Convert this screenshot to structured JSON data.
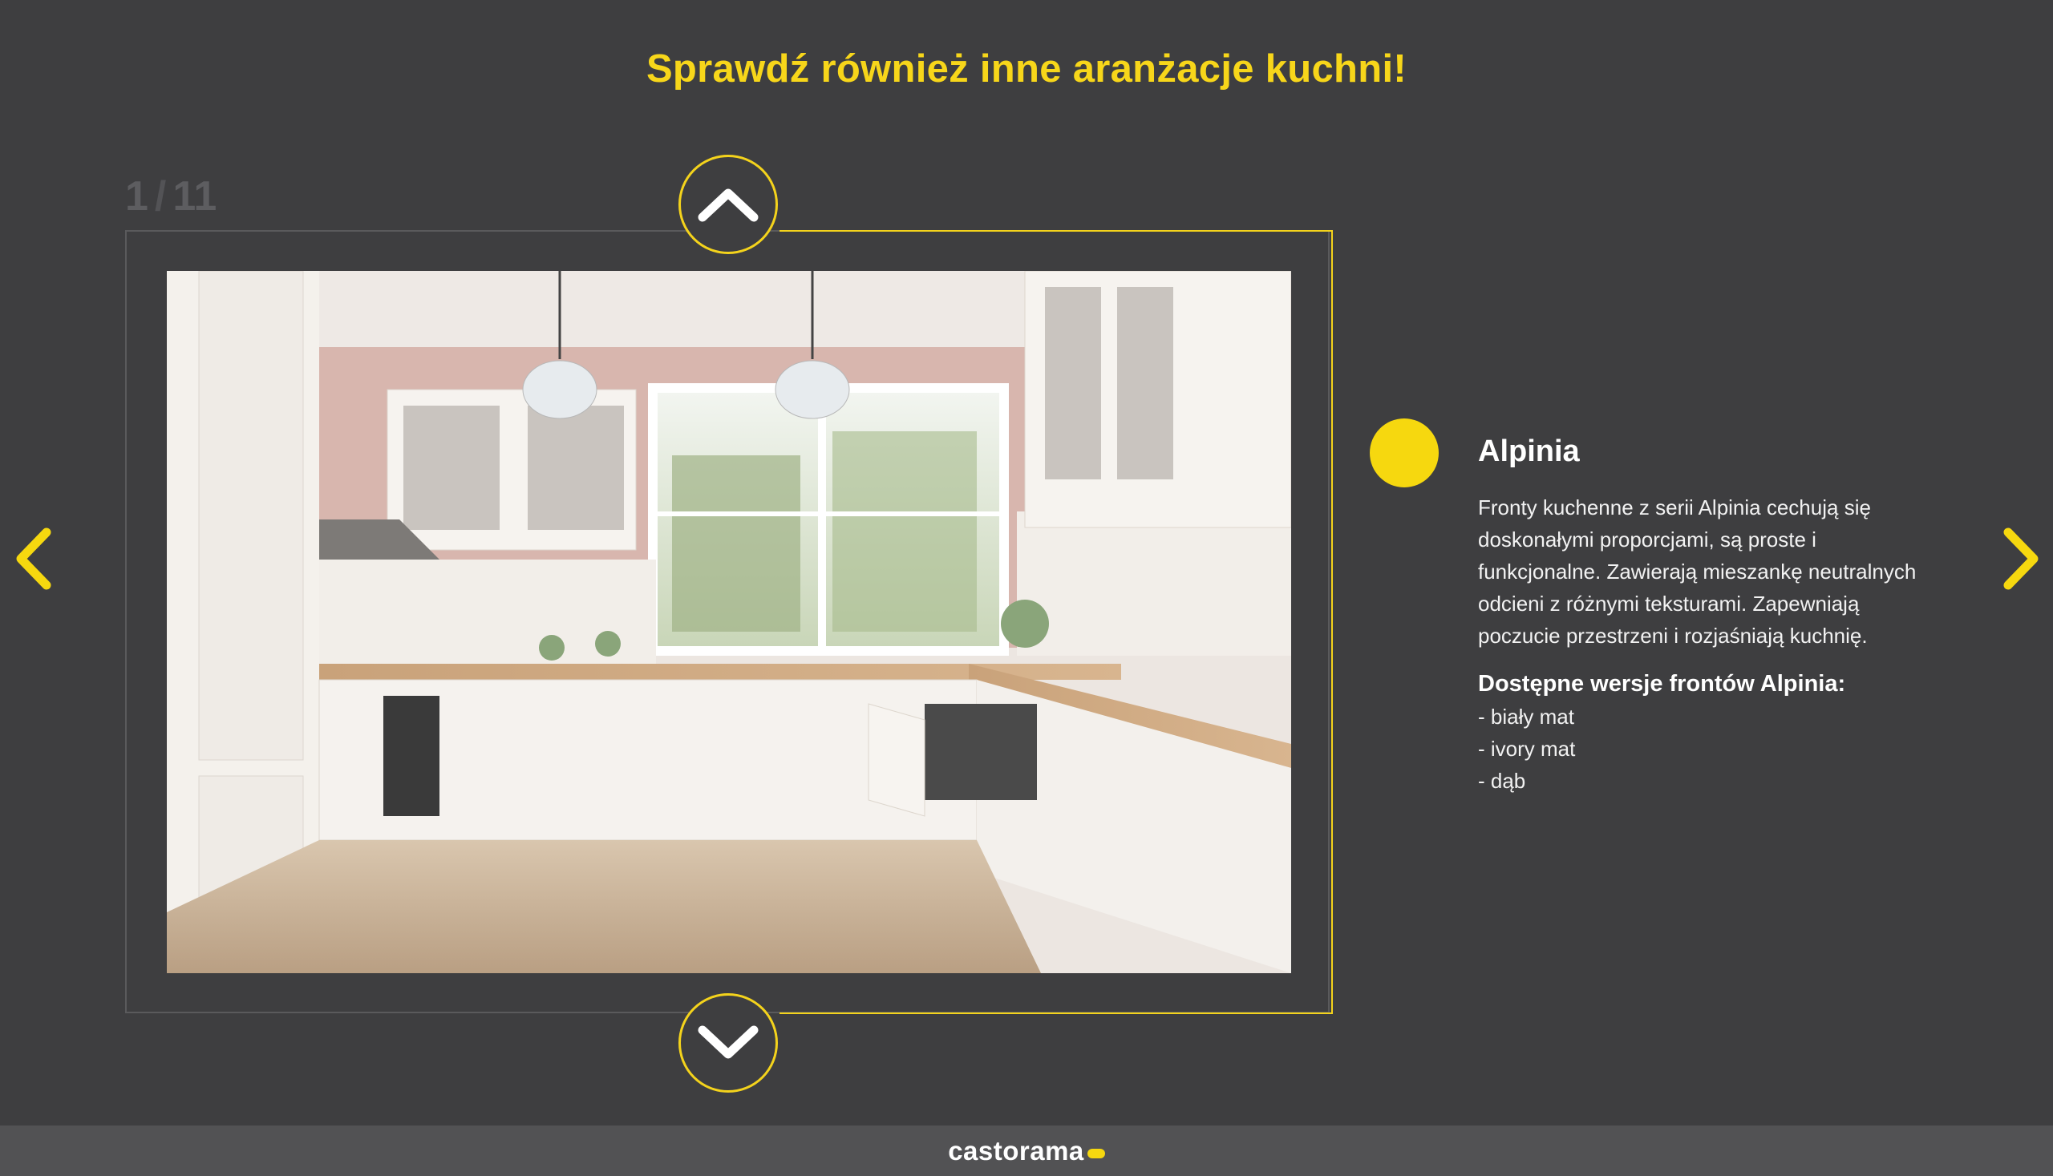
{
  "header": {
    "title": "Sprawdź również inne aranżacje kuchni!"
  },
  "gallery": {
    "current": "1",
    "separator": "/",
    "total": "11",
    "image_alt": "Kuchnia Alpinia",
    "prev_icon": "chevron-up-icon",
    "next_icon": "chevron-down-icon",
    "left_icon": "chevron-left-icon",
    "right_icon": "chevron-right-icon"
  },
  "product": {
    "title": "Alpinia",
    "description": "Fronty kuchenne z serii Alpinia cechują się doskonałymi proporcjami, są proste i funkcjonalne. Zawierają mieszankę neutralnych odcieni z różnymi teksturami. Zapewniają poczucie przestrzeni i rozjaśniają kuchnię.",
    "versions_heading": "Dostępne wersje frontów Alpinia:",
    "versions": [
      "- biały mat",
      "- ivory mat",
      "- dąb"
    ]
  },
  "footer": {
    "logo_text": "castorama"
  },
  "colors": {
    "accent": "#f6d80f",
    "background": "#3e3e40",
    "footer": "#525254"
  }
}
